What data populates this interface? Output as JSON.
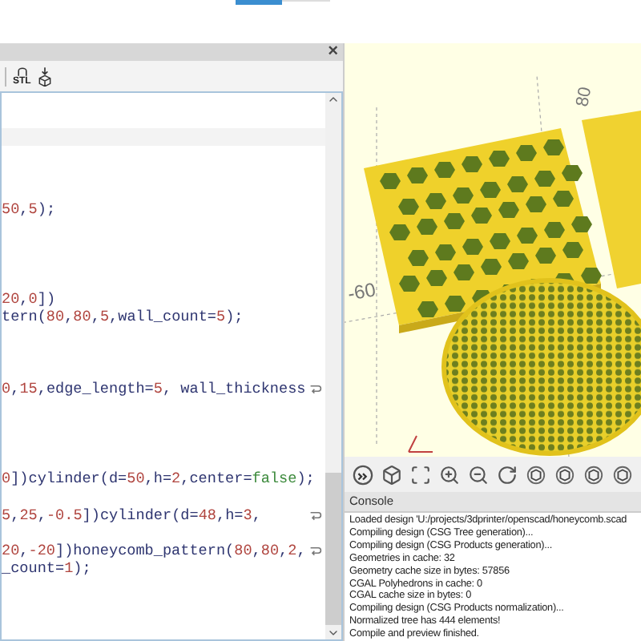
{
  "top_tab": {
    "selected": true
  },
  "editor": {
    "close": "×",
    "toolbar": [
      {
        "kind": "stl",
        "label": "STL"
      },
      {
        "kind": "cube"
      }
    ],
    "cursor_line_highlight": true,
    "lines": [
      {
        "wrapped": false,
        "parts": [
          {
            "kind": "num",
            "t": "50"
          },
          {
            "kind": "plain",
            "t": ","
          },
          {
            "kind": "num",
            "t": "5"
          },
          {
            "kind": "plain",
            "t": ");"
          }
        ]
      },
      {
        "wrapped": false,
        "parts": [
          {
            "kind": "num",
            "t": "20"
          },
          {
            "kind": "plain",
            "t": ","
          },
          {
            "kind": "num",
            "t": "0"
          },
          {
            "kind": "plain",
            "t": "])"
          }
        ]
      },
      {
        "wrapped": false,
        "parts": [
          {
            "kind": "plain",
            "t": "tern("
          },
          {
            "kind": "num",
            "t": "80"
          },
          {
            "kind": "plain",
            "t": ","
          },
          {
            "kind": "num",
            "t": "80"
          },
          {
            "kind": "plain",
            "t": ","
          },
          {
            "kind": "num",
            "t": "5"
          },
          {
            "kind": "plain",
            "t": ",wall_count="
          },
          {
            "kind": "num",
            "t": "5"
          },
          {
            "kind": "plain",
            "t": ");"
          }
        ]
      },
      {
        "wrapped": true,
        "parts": [
          {
            "kind": "num",
            "t": "0"
          },
          {
            "kind": "plain",
            "t": ","
          },
          {
            "kind": "num",
            "t": "15"
          },
          {
            "kind": "plain",
            "t": ",edge_length="
          },
          {
            "kind": "num",
            "t": "5"
          },
          {
            "kind": "plain",
            "t": ", wall_thickness"
          }
        ]
      },
      {
        "wrapped": false,
        "parts": [
          {
            "kind": "num",
            "t": "0"
          },
          {
            "kind": "plain",
            "t": "])cylinder(d="
          },
          {
            "kind": "num",
            "t": "50"
          },
          {
            "kind": "plain",
            "t": ",h="
          },
          {
            "kind": "num",
            "t": "2"
          },
          {
            "kind": "plain",
            "t": ",center="
          },
          {
            "kind": "keyword",
            "t": "false"
          },
          {
            "kind": "plain",
            "t": ");"
          }
        ]
      },
      {
        "wrapped": true,
        "parts": [
          {
            "kind": "num",
            "t": "5"
          },
          {
            "kind": "plain",
            "t": ","
          },
          {
            "kind": "num",
            "t": "25"
          },
          {
            "kind": "plain",
            "t": ","
          },
          {
            "kind": "num",
            "t": "-0.5"
          },
          {
            "kind": "plain",
            "t": "])cylinder(d="
          },
          {
            "kind": "num",
            "t": "48"
          },
          {
            "kind": "plain",
            "t": ",h="
          },
          {
            "kind": "num",
            "t": "3"
          },
          {
            "kind": "plain",
            "t": ","
          }
        ]
      },
      {
        "wrapped": true,
        "parts": [
          {
            "kind": "num",
            "t": "20"
          },
          {
            "kind": "plain",
            "t": ","
          },
          {
            "kind": "num",
            "t": "-20"
          },
          {
            "kind": "plain",
            "t": "])honeycomb_pattern("
          },
          {
            "kind": "num",
            "t": "80"
          },
          {
            "kind": "plain",
            "t": ","
          },
          {
            "kind": "num",
            "t": "80"
          },
          {
            "kind": "plain",
            "t": ","
          },
          {
            "kind": "num",
            "t": "2"
          },
          {
            "kind": "plain",
            "t": ","
          }
        ]
      },
      {
        "wrapped": false,
        "parts": [
          {
            "kind": "plain",
            "t": "_count="
          },
          {
            "kind": "num",
            "t": "1"
          },
          {
            "kind": "plain",
            "t": ");"
          }
        ]
      }
    ]
  },
  "viewport": {
    "axis_labels": [
      "80",
      "-60"
    ]
  },
  "view_toolbar": [
    {
      "kind": "render"
    },
    {
      "kind": "preview"
    },
    {
      "kind": "view-all"
    },
    {
      "kind": "zoom-in"
    },
    {
      "kind": "zoom-out"
    },
    {
      "kind": "reset"
    },
    {
      "kind": "view"
    },
    {
      "kind": "view"
    },
    {
      "kind": "view"
    },
    {
      "kind": "view"
    }
  ],
  "console": {
    "title": "Console",
    "lines": [
      "Loaded design 'U:/projects/3dprinter/openscad/honeycomb.scad",
      "Compiling design (CSG Tree generation)...",
      "Compiling design (CSG Products generation)...",
      "Geometries in cache: 32",
      "Geometry cache size in bytes: 57856",
      "CGAL Polyhedrons in cache: 0",
      "CGAL cache size in bytes: 0",
      "Compiling design (CSG Products normalization)...",
      "Normalized tree has 444 elements!",
      "Compile and preview finished."
    ]
  }
}
